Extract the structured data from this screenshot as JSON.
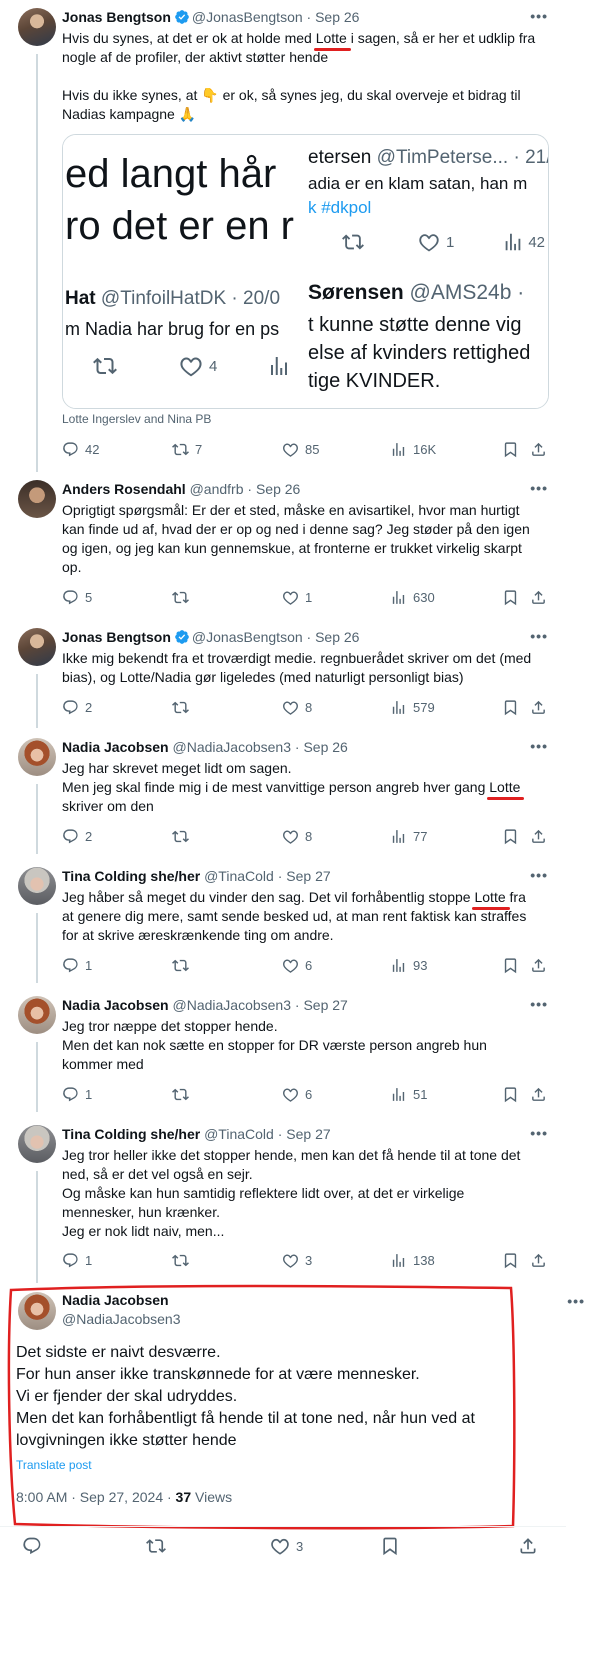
{
  "colors": {
    "accent": "#1d9bf0",
    "text": "#0f1419",
    "muted": "#536471",
    "highlight": "#e02020"
  },
  "posts": [
    {
      "name": "Jonas Bengtson",
      "handle": "@JonasBengtson",
      "date": "Sep 26",
      "verified": true,
      "lines": [
        "Hvis du synes, at det er ok at holde med ",
        "Lotte",
        " i sagen, så er her et udklip fra",
        "nogle af de profiler, der aktivt støtter hende",
        "Hvis du ikke synes, at 👇 er ok, så synes jeg, du skal overveje et bidrag til",
        "Nadias kampagne 🙏"
      ],
      "caption": "Lotte Ingerslev and Nina PB",
      "replies": "42",
      "reposts": "7",
      "likes": "85",
      "views": "16K"
    },
    {
      "name": "Anders Rosendahl",
      "handle": "@andfrb",
      "date": "Sep 26",
      "lines": [
        "Oprigtigt spørgsmål: Er der et sted, måske en avisartikel, hvor man hurtigt",
        "kan finde ud af, hvad der er op og ned i denne sag? Jeg støder på den igen",
        "og igen, og jeg kan kun gennemskue, at fronterne er trukket virkelig skarpt",
        "op."
      ],
      "replies": "5",
      "reposts": "",
      "likes": "1",
      "views": "630"
    },
    {
      "name": "Jonas Bengtson",
      "handle": "@JonasBengtson",
      "date": "Sep 26",
      "verified": true,
      "lines": [
        "Ikke mig bekendt fra et troværdigt medie. regnbuerådet skriver om det (med",
        "bias), og Lotte/Nadia gør ligeledes (med naturligt personligt bias)"
      ],
      "replies": "2",
      "reposts": "",
      "likes": "8",
      "views": "579"
    },
    {
      "name": "Nadia Jacobsen",
      "handle": "@NadiaJacobsen3",
      "date": "Sep 26",
      "lines": [
        "Jeg har skrevet meget lidt om sagen.",
        "Men jeg skal finde mig i de mest vanvittige person angreb hver gang ",
        "Lotte",
        "skriver om den"
      ],
      "replies": "2",
      "reposts": "",
      "likes": "8",
      "views": "77"
    },
    {
      "name": "Tina Colding she/her",
      "handle": "@TinaCold",
      "date": "Sep 27",
      "lines": [
        "Jeg håber så meget du vinder den sag. Det vil forhåbentlig stoppe ",
        "Lotte",
        " fra",
        "at genere dig mere, samt sende besked ud, at man rent faktisk kan straffes",
        "for at skrive æreskrænkende ting om andre."
      ],
      "replies": "1",
      "reposts": "",
      "likes": "6",
      "views": "93"
    },
    {
      "name": "Nadia Jacobsen",
      "handle": "@NadiaJacobsen3",
      "date": "Sep 27",
      "lines": [
        "Jeg tror næppe det stopper hende.",
        "Men det kan nok sætte en stopper for DR værste person angreb hun",
        "kommer med"
      ],
      "replies": "1",
      "reposts": "",
      "likes": "6",
      "views": "51"
    },
    {
      "name": "Tina Colding she/her",
      "handle": "@TinaCold",
      "date": "Sep 27",
      "lines": [
        "Jeg tror heller ikke det stopper hende, men kan det få hende til at tone det",
        "ned, så er det vel også en sejr.",
        "Og måske kan hun samtidig reflektere lidt over, at det er virkelige",
        "mennesker, hun krænker.",
        "Jeg er nok lidt naiv, men..."
      ],
      "replies": "1",
      "reposts": "",
      "likes": "3",
      "views": "138"
    }
  ],
  "quote": {
    "tl_line1": "ed langt hår",
    "tl_line2": "ro det er en r",
    "tr_name": "etersen",
    "tr_handle": "@TimPeterse...",
    "tr_date": "· 21/0",
    "tr_text": "adia er en klam satan, han m",
    "tr_tag": "k #dkpol",
    "tr_likes": "1",
    "tr_views": "42",
    "bl_name": "Hat",
    "bl_handle": "@TinfoilHatDK",
    "bl_date": "· 20/0",
    "bl_text": "m Nadia har brug for en ps",
    "bl_likes": "4",
    "br_name": "Sørensen",
    "br_handle": "@AMS24b",
    "br_date": "·",
    "br_line1": "t kunne støtte denne vig",
    "br_line2": "else af kvinders rettighed",
    "br_line3": "tige KVINDER."
  },
  "focus": {
    "name": "Nadia Jacobsen",
    "handle": "@NadiaJacobsen3",
    "lines": [
      "Det sidste er naivt desværre.",
      "For hun anser ikke transkønnede for at være mennesker.",
      "Vi er fjender der skal udryddes.",
      "Men det kan forhåbentligt få hende til at tone ned, når hun ved at",
      "lovgivningen ikke støtter hende"
    ],
    "translate": "Translate post",
    "timestamp": "8:00 AM · Sep 27, 2024 · ",
    "views_count": "37",
    "views_label": " Views",
    "likes": "3"
  },
  "icons": [
    "reply-icon",
    "repost-icon",
    "like-icon",
    "views-icon",
    "bookmark-icon",
    "share-icon",
    "more-icon",
    "verified-icon"
  ]
}
